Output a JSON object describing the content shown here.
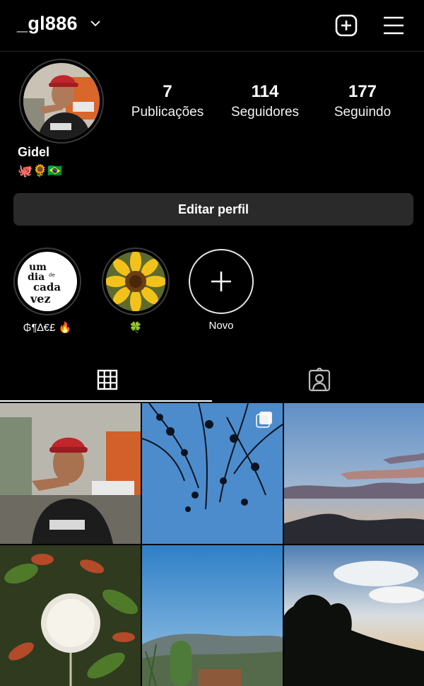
{
  "header": {
    "username": "_gl886",
    "new_post_icon": "plus-square-icon",
    "menu_icon": "hamburger-menu-icon"
  },
  "profile": {
    "name": "Gidel",
    "bio": "🐙🌻🇧🇷",
    "stats": [
      {
        "value": "7",
        "label": "Publicações"
      },
      {
        "value": "114",
        "label": "Seguidores"
      },
      {
        "value": "177",
        "label": "Seguindo"
      }
    ],
    "edit_button": "Editar perfil"
  },
  "highlights": [
    {
      "label": "₲¶∆€£ 🔥",
      "cover_text": [
        "um",
        "dia",
        "de",
        "cada",
        "vez"
      ]
    },
    {
      "label": "🍀"
    },
    {
      "label": "Novo"
    }
  ],
  "tabs": [
    {
      "icon": "grid-icon",
      "active": true
    },
    {
      "icon": "tagged-person-icon",
      "active": false
    }
  ],
  "colors": {
    "background": "#000000",
    "button_bg": "#2a2a2a",
    "divider": "#262626"
  }
}
